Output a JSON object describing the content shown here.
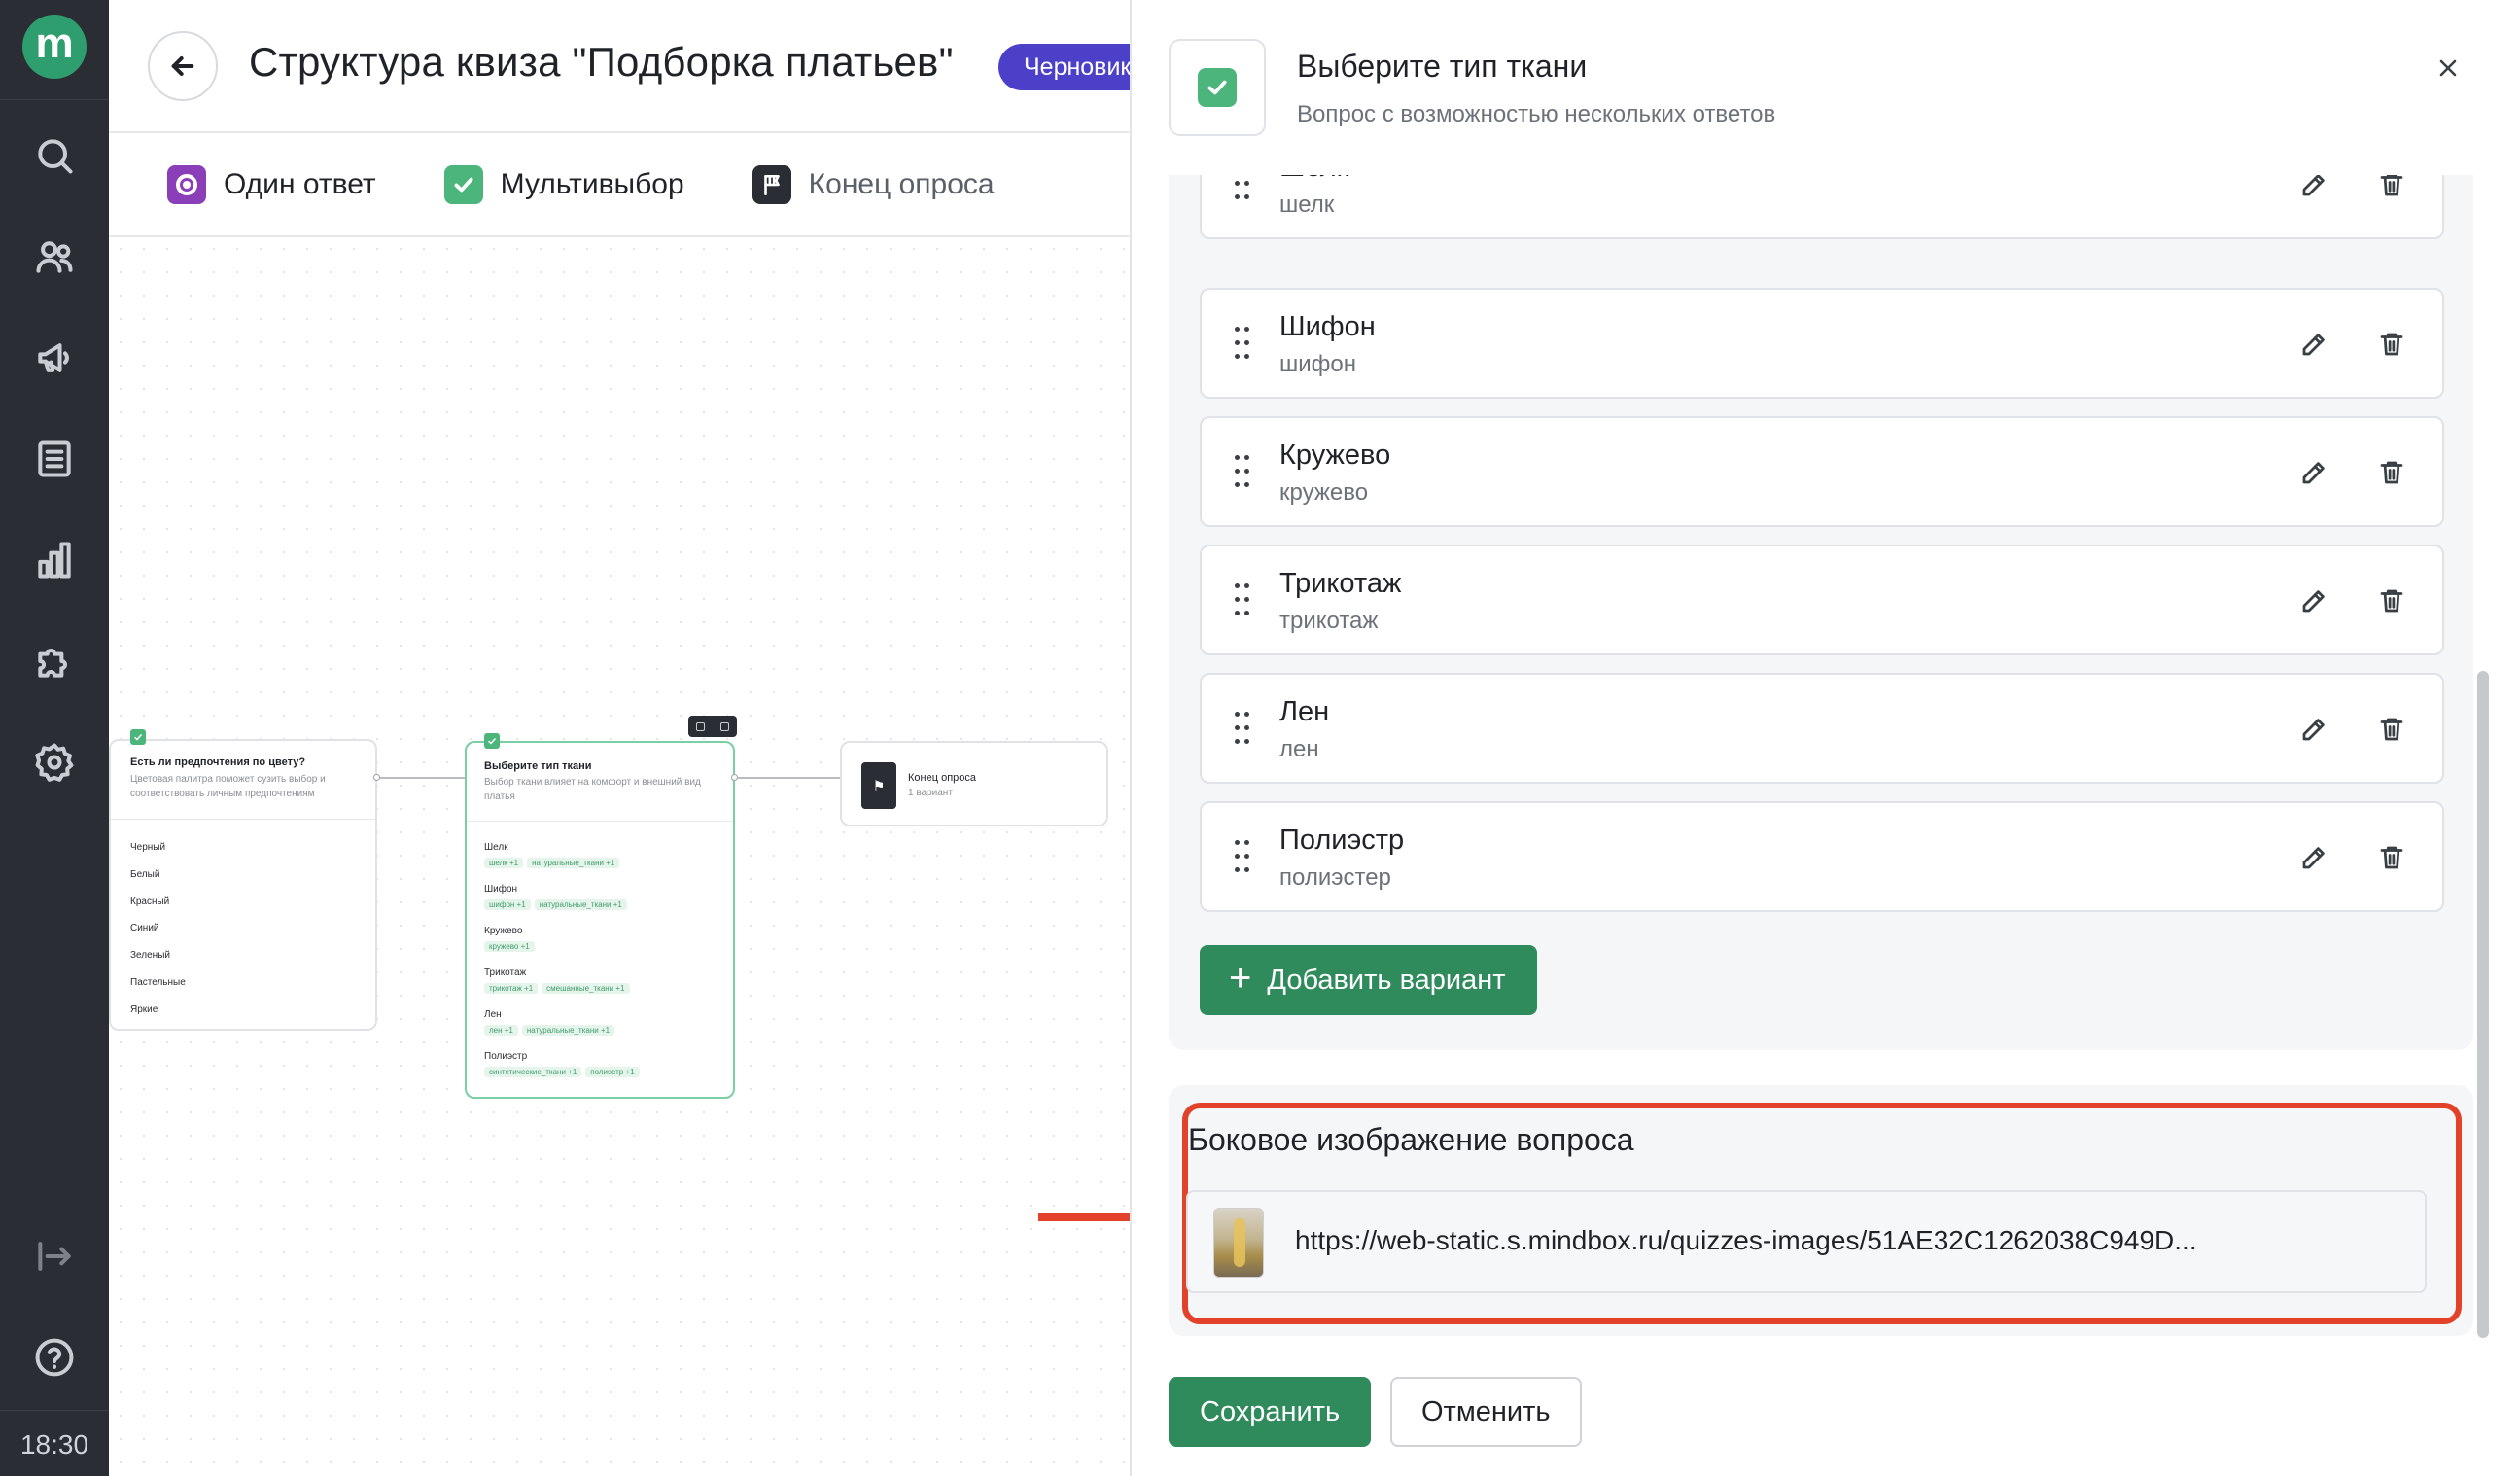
{
  "app": {
    "logo_letter": "m",
    "clock": "18:30",
    "nav_icons": [
      "search-icon",
      "users-icon",
      "megaphone-icon",
      "document-list-icon",
      "bar-chart-icon",
      "puzzle-icon",
      "gear-icon",
      "exit-icon",
      "help-icon"
    ]
  },
  "header": {
    "title": "Структура квиза \"Подборка платьев\"",
    "status": "Черновик"
  },
  "toolbar": {
    "single": "Один ответ",
    "multi": "Мультивыбор",
    "end": "Конец опроса"
  },
  "canvas": {
    "node1": {
      "title": "Есть ли предпочтения по цвету?",
      "subtitle": "Цветовая палитра поможет сузить выбор и соответствовать личным предпочтениям",
      "items": [
        "Черный",
        "Белый",
        "Красный",
        "Синий",
        "Зеленый",
        "Пастельные",
        "Яркие"
      ]
    },
    "node2": {
      "title": "Выберите тип ткани",
      "subtitle": "Выбор ткани влияет на комфорт и внешний вид платья",
      "items": [
        {
          "label": "Шелк",
          "tags": [
            "шелк +1",
            "натуральные_ткани +1"
          ]
        },
        {
          "label": "Шифон",
          "tags": [
            "шифон +1",
            "натуральные_ткани +1"
          ]
        },
        {
          "label": "Кружево",
          "tags": [
            "кружево +1"
          ]
        },
        {
          "label": "Трикотаж",
          "tags": [
            "трикотаж +1",
            "смешанные_ткани +1"
          ]
        },
        {
          "label": "Лен",
          "tags": [
            "лен +1",
            "натуральные_ткани +1"
          ]
        },
        {
          "label": "Полиэстр",
          "tags": [
            "синтетические_ткани +1",
            "полиэстр +1"
          ]
        }
      ]
    },
    "node3": {
      "title": "Конец опроса",
      "subtitle": "1 вариант"
    }
  },
  "panel": {
    "title": "Выберите тип ткани",
    "subtitle": "Вопрос с возможностью нескольких ответов",
    "options": [
      {
        "label": "Шелк",
        "tag": "шелк"
      },
      {
        "label": "Шифон",
        "tag": "шифон"
      },
      {
        "label": "Кружево",
        "tag": "кружево"
      },
      {
        "label": "Трикотаж",
        "tag": "трикотаж"
      },
      {
        "label": "Лен",
        "tag": "лен"
      },
      {
        "label": "Полиэстр",
        "tag": "полиэстер"
      }
    ],
    "add_option": "Добавить вариант",
    "side_image_title": "Боковое изображение вопроса",
    "side_image_url": "https://web-static.s.mindbox.ru/quizzes-images/51AE32C1262038C949D...",
    "save": "Сохранить",
    "cancel": "Отменить"
  },
  "colors": {
    "accent_green": "#2f8a5c",
    "check_green": "#4bb57c",
    "draft_badge": "#4c40c9",
    "highlight_red": "#e2412a",
    "nav_bg": "#2a2d33"
  }
}
